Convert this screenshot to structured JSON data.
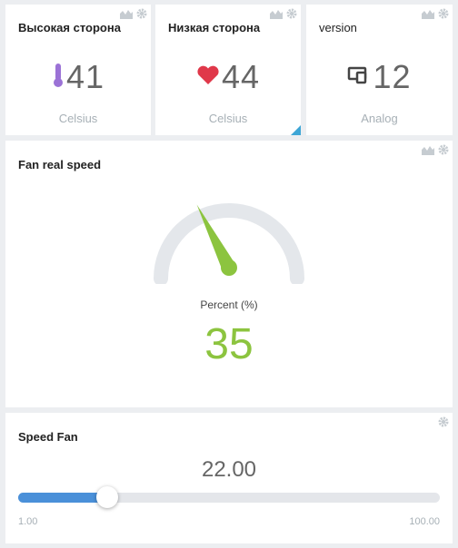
{
  "widgets": {
    "high_side": {
      "title": "Высокая сторона",
      "value": "41",
      "unit": "Celsius",
      "icon": "thermometer-icon",
      "icon_color": "#9b72d6"
    },
    "low_side": {
      "title": "Низкая сторона",
      "value": "44",
      "unit": "Celsius",
      "icon": "heart-icon",
      "icon_color": "#e0384a"
    },
    "version": {
      "title": "version",
      "value": "12",
      "unit": "Analog",
      "icon": "devices-icon"
    },
    "fan_real_speed": {
      "title": "Fan real speed",
      "label": "Percent (%)",
      "value": "35",
      "percent": 35,
      "color": "#8cc43f"
    },
    "speed_fan": {
      "title": "Speed Fan",
      "value": "22.00",
      "min": "1.00",
      "max": "100.00",
      "fraction": 0.212,
      "fill_color": "#4a90d9"
    }
  }
}
